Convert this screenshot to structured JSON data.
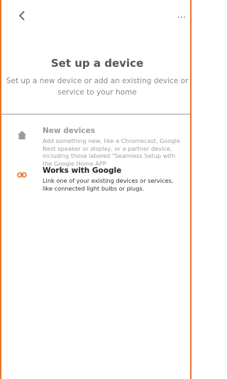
{
  "header": {
    "back_icon": "back-chevron-icon",
    "more_label": "..."
  },
  "intro": {
    "title": "Set up a device",
    "subtitle": "Set up a new device or add an existing device or service to your home"
  },
  "options": [
    {
      "icon": "home-icon",
      "title": "New devices",
      "description": "Add something new, like a Chromecast, Google Nest speaker or display, or a partner device, including those labeled \"Seamless Setup with the Google Home APP"
    },
    {
      "icon": "link-icon",
      "title": "Works with Google",
      "description": "Link one of your existing devices or services, like connected light bulbs or plugs."
    }
  ],
  "colors": {
    "accent": "#e8732c",
    "link_icon": "#e8732c",
    "home_icon": "#9a9a9a"
  }
}
